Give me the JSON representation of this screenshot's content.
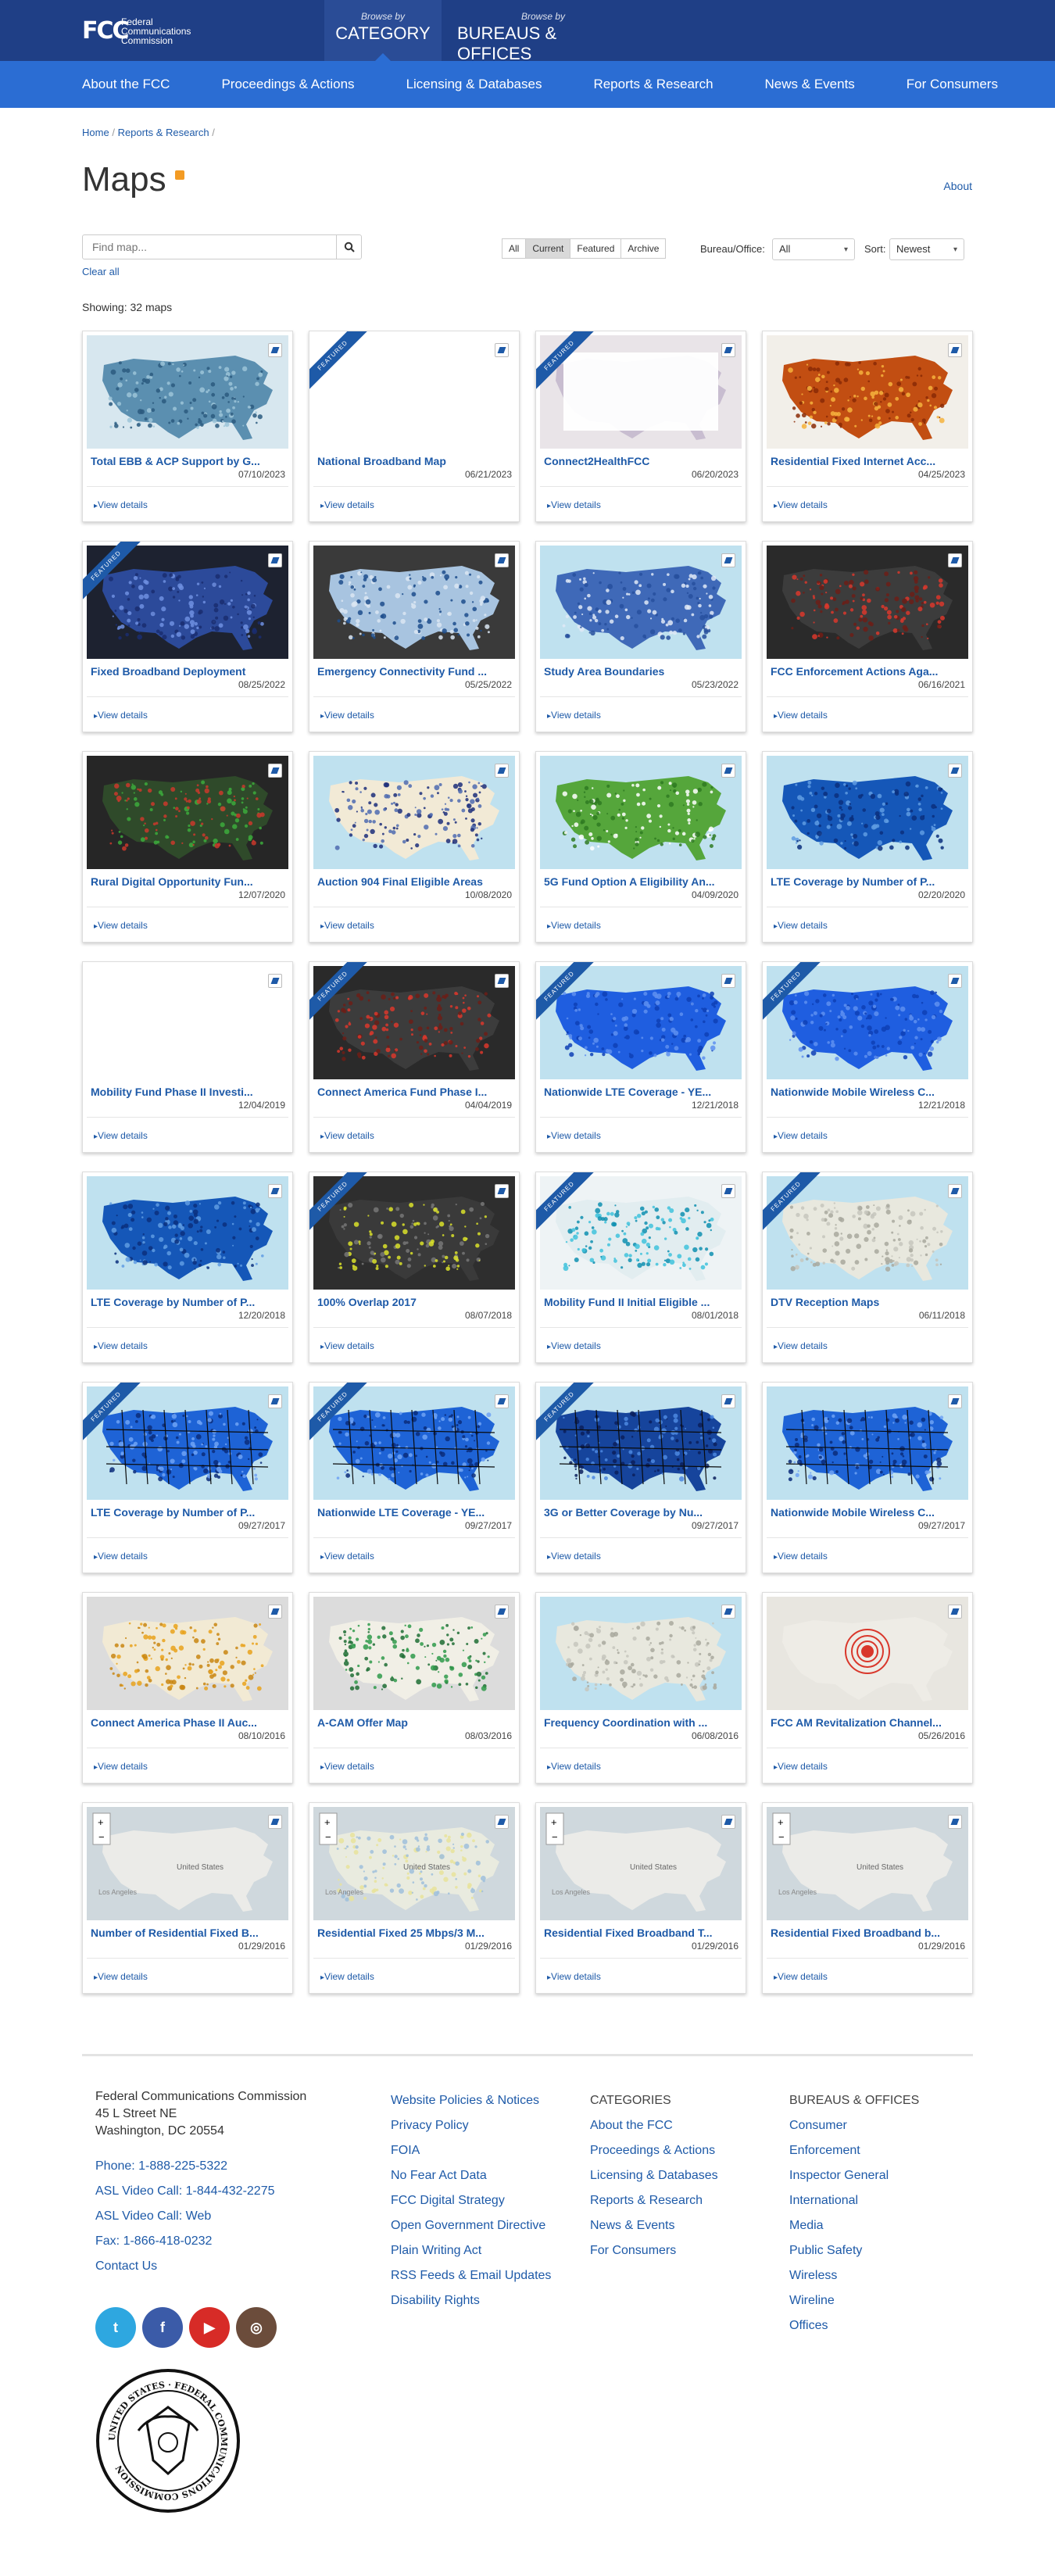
{
  "header": {
    "logo_mark": "FCC",
    "logo_lines": [
      "Federal",
      "Communications",
      "Commission"
    ],
    "browse_by": "Browse by",
    "category": "CATEGORY",
    "bureaus": "BUREAUS & OFFICES"
  },
  "nav": [
    "About the FCC",
    "Proceedings & Actions",
    "Licensing & Databases",
    "Reports & Research",
    "News & Events",
    "For Consumers"
  ],
  "breadcrumb": {
    "home": "Home",
    "sep": "/",
    "current": "Reports & Research",
    "trail": "/"
  },
  "page": {
    "title": "Maps",
    "about": "About"
  },
  "search": {
    "placeholder": "Find map...",
    "clear_all": "Clear all"
  },
  "filters": [
    "All",
    "Current",
    "Featured",
    "Archive"
  ],
  "bureau": {
    "label": "Bureau/Office:",
    "value": "All"
  },
  "sort": {
    "label": "Sort:",
    "value": "Newest"
  },
  "showing": "Showing: 32 maps",
  "ribbon_text": "FEATURED",
  "view_details": "View details",
  "maps": [
    {
      "title": "Total EBB & ACP Support by G...",
      "date": "07/10/2023",
      "featured": false,
      "theme": "choropleth-blue"
    },
    {
      "title": "National Broadband Map",
      "date": "06/21/2023",
      "featured": true,
      "theme": "blank"
    },
    {
      "title": "Connect2HealthFCC",
      "date": "06/20/2023",
      "featured": true,
      "theme": "health"
    },
    {
      "title": "Residential Fixed Internet Acc...",
      "date": "04/25/2023",
      "featured": false,
      "theme": "heat-red"
    },
    {
      "title": "Fixed Broadband Deployment",
      "date": "08/25/2022",
      "featured": true,
      "theme": "dark-blue"
    },
    {
      "title": "Emergency Connectivity Fund ...",
      "date": "05/25/2022",
      "featured": false,
      "theme": "states-blue"
    },
    {
      "title": "Study Area Boundaries",
      "date": "05/23/2022",
      "featured": false,
      "theme": "boundaries"
    },
    {
      "title": "FCC Enforcement Actions Aga...",
      "date": "06/16/2021",
      "featured": false,
      "theme": "dark-red"
    },
    {
      "title": "Rural Digital Opportunity Fun...",
      "date": "12/07/2020",
      "featured": false,
      "theme": "dark-green"
    },
    {
      "title": "Auction 904 Final Eligible Areas",
      "date": "10/08/2020",
      "featured": false,
      "theme": "dots-navy"
    },
    {
      "title": "5G Fund Option A Eligibility An...",
      "date": "04/09/2020",
      "featured": false,
      "theme": "green"
    },
    {
      "title": "LTE Coverage by Number of P...",
      "date": "02/20/2020",
      "featured": false,
      "theme": "lte"
    },
    {
      "title": "Mobility Fund Phase II Investi...",
      "date": "12/04/2019",
      "featured": false,
      "theme": "blank"
    },
    {
      "title": "Connect America Fund Phase I...",
      "date": "04/04/2019",
      "featured": true,
      "theme": "dark-red"
    },
    {
      "title": "Nationwide LTE Coverage - YE...",
      "date": "12/21/2018",
      "featured": true,
      "theme": "bright-blue"
    },
    {
      "title": "Nationwide Mobile Wireless C...",
      "date": "12/21/2018",
      "featured": true,
      "theme": "bright-blue"
    },
    {
      "title": "LTE Coverage by Number of P...",
      "date": "12/20/2018",
      "featured": false,
      "theme": "lte"
    },
    {
      "title": "100% Overlap 2017",
      "date": "08/07/2018",
      "featured": true,
      "theme": "dark-yellow"
    },
    {
      "title": "Mobility Fund II Initial Eligible ...",
      "date": "08/01/2018",
      "featured": true,
      "theme": "cyan"
    },
    {
      "title": "DTV Reception Maps",
      "date": "06/11/2018",
      "featured": true,
      "theme": "basemap"
    },
    {
      "title": "LTE Coverage by Number of P...",
      "date": "09/27/2017",
      "featured": true,
      "theme": "counties-blue"
    },
    {
      "title": "Nationwide LTE Coverage - YE...",
      "date": "09/27/2017",
      "featured": true,
      "theme": "counties-blue"
    },
    {
      "title": "3G or Better Coverage by Nu...",
      "date": "09/27/2017",
      "featured": true,
      "theme": "counties-navy"
    },
    {
      "title": "Nationwide Mobile Wireless C...",
      "date": "09/27/2017",
      "featured": false,
      "theme": "counties-blue"
    },
    {
      "title": "Connect America Phase II Auc...",
      "date": "08/10/2016",
      "featured": false,
      "theme": "orange"
    },
    {
      "title": "A-CAM Offer Map",
      "date": "08/03/2016",
      "featured": false,
      "theme": "green-dots"
    },
    {
      "title": "Frequency Coordination with ...",
      "date": "06/08/2016",
      "featured": false,
      "theme": "basemap"
    },
    {
      "title": "FCC AM Revitalization Channel...",
      "date": "05/26/2016",
      "featured": false,
      "theme": "am"
    },
    {
      "title": "Number of Residential Fixed B...",
      "date": "01/29/2016",
      "featured": false,
      "theme": "gray-map"
    },
    {
      "title": "Residential Fixed 25 Mbps/3 M...",
      "date": "01/29/2016",
      "featured": false,
      "theme": "pale"
    },
    {
      "title": "Residential Fixed Broadband T...",
      "date": "01/29/2016",
      "featured": false,
      "theme": "gray-map"
    },
    {
      "title": "Residential Fixed Broadband b...",
      "date": "01/29/2016",
      "featured": false,
      "theme": "gray-map"
    }
  ],
  "map_labels": {
    "us": "United States",
    "la": "Los Angeles",
    "plus": "+",
    "minus": "−"
  },
  "footer": {
    "address": [
      "Federal Communications Commission",
      "45 L Street NE",
      "Washington, DC 20554"
    ],
    "contact": [
      "Phone: 1-888-225-5322",
      "ASL Video Call: 1-844-432-2275",
      "ASL Video Call: Web",
      "Fax: 1-866-418-0232",
      "Contact Us"
    ],
    "policies": [
      "Website Policies & Notices",
      "Privacy Policy",
      "FOIA",
      "No Fear Act Data",
      "FCC Digital Strategy",
      "Open Government Directive",
      "Plain Writing Act",
      "RSS Feeds & Email Updates",
      "Disability Rights"
    ],
    "categories_head": "CATEGORIES",
    "categories": [
      "About the FCC",
      "Proceedings & Actions",
      "Licensing & Databases",
      "Reports & Research",
      "News & Events",
      "For Consumers"
    ],
    "bureaus_head": "BUREAUS & OFFICES",
    "bureaus": [
      "Consumer",
      "Enforcement",
      "Inspector General",
      "International",
      "Media",
      "Public Safety",
      "Wireless",
      "Wireline",
      "Offices"
    ],
    "social": [
      {
        "name": "twitter-icon",
        "color": "#2ea7e0",
        "glyph": "t"
      },
      {
        "name": "facebook-icon",
        "color": "#3b5ba8",
        "glyph": "f"
      },
      {
        "name": "youtube-icon",
        "color": "#d72b27",
        "glyph": "▶"
      },
      {
        "name": "instagram-icon",
        "color": "#6b4c3b",
        "glyph": "◎"
      }
    ],
    "seal_text": "UNITED STATES · FEDERAL COMMUNICATIONS COMMISSION"
  },
  "colors": {
    "header": "#1f3f86",
    "nav": "#2b6dd3",
    "link": "#1e5aa8"
  }
}
